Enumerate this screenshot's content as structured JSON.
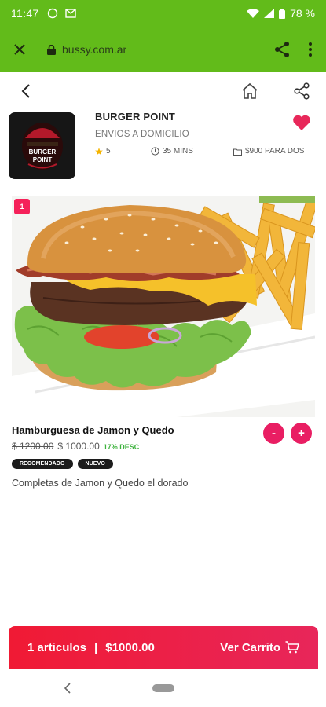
{
  "status": {
    "time": "11:47",
    "battery": "78 %"
  },
  "browser": {
    "url": "bussy.com.ar"
  },
  "store": {
    "name": "BURGER POINT",
    "subtitle": "ENVIOS A DOMICILIO",
    "rating": "5",
    "time": "35 MINS",
    "price_for_two": "$900 PARA DOS",
    "logo_text_1": "BURGER",
    "logo_text_2": "POINT"
  },
  "product": {
    "badge": "1",
    "title": "Hamburguesa de Jamon y Quedo",
    "old_price": "$ 1200.00",
    "new_price": "$ 1000.00",
    "discount": "17% DESC",
    "tags": [
      "RECOMENDADO",
      "NUEVO"
    ],
    "description": "Completas de Jamon y Quedo el dorado",
    "minus": "-",
    "plus": "+"
  },
  "cart": {
    "items": "1 articulos",
    "separator": "|",
    "total": "$1000.00",
    "button": "Ver Carrito"
  },
  "colors": {
    "status_green": "#62bb1a",
    "accent_pink": "#e91e63",
    "discount_green": "#3cb23c"
  }
}
